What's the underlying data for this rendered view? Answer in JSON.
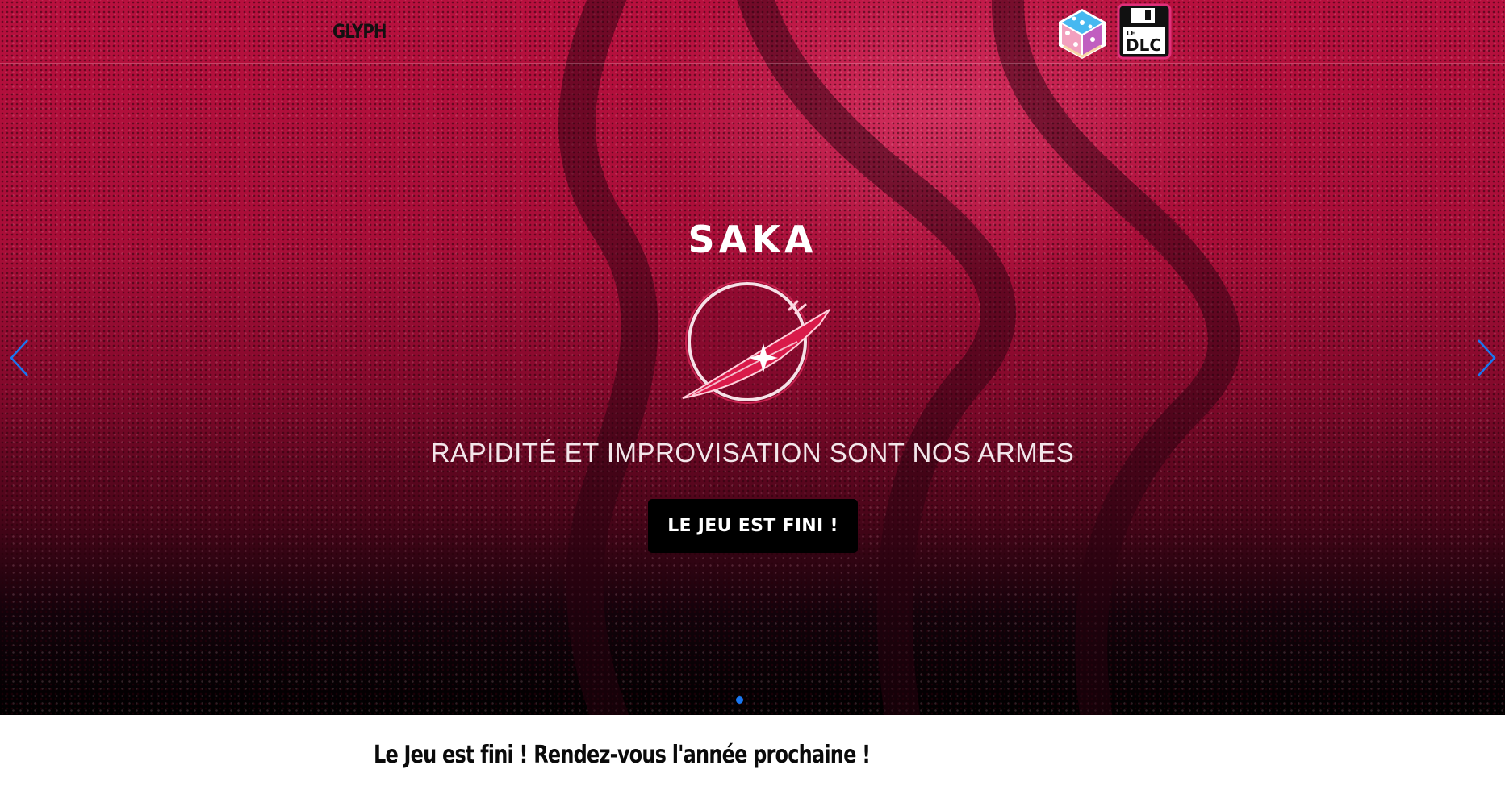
{
  "header": {
    "brand": "GLYPH",
    "partners": [
      {
        "icon": "dice-logo-icon"
      },
      {
        "icon": "le-dlc-floppy-logo-icon",
        "logo_text_top": "LE",
        "logo_text_main": "DLC"
      }
    ]
  },
  "hero": {
    "title": "SAKA",
    "emblem_icon": "saka-knife-emblem-icon",
    "tagline": "RAPIDITÉ ET IMPROVISATION SONT NOS ARMES",
    "cta_label": "LE JEU EST FINI !",
    "prev_icon": "chevron-left-icon",
    "next_icon": "chevron-right-icon",
    "slide_count": 1,
    "active_slide": 1
  },
  "main": {
    "notice": "Le Jeu est fini ! Rendez-vous l'année prochaine !"
  },
  "colors": {
    "hero_red": "#b8103e",
    "hero_dark": "#000000",
    "cta_background": "#000000",
    "arrow_blue": "#1877f2",
    "dot_active": "#1877f2"
  }
}
